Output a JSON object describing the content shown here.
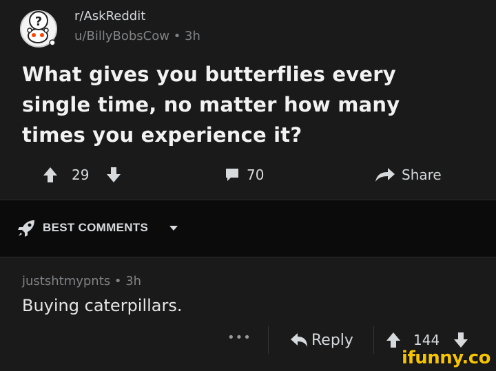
{
  "post": {
    "subreddit": "r/AskReddit",
    "author": "u/BillyBobsCow",
    "age": "3h",
    "title": "What gives you butterflies every single time, no matter how many times you experience it?",
    "upvotes": "29",
    "comments": "70",
    "share_label": "Share"
  },
  "sort": {
    "label": "BEST COMMENTS"
  },
  "comment": {
    "author": "justshtmypnts",
    "age": "3h",
    "body": "Buying caterpillars.",
    "more": "•••",
    "reply_label": "Reply",
    "score": "144"
  },
  "watermark": "ifunny.co",
  "colors": {
    "background": "#1a1a1b",
    "sortbar": "#0b0b0c",
    "text": "#d7dadc",
    "muted": "#818384",
    "watermark": "#f5c400"
  },
  "icons": [
    "subreddit-avatar-icon",
    "upvote-icon",
    "downvote-icon",
    "comment-icon",
    "share-icon",
    "rocket-icon",
    "caret-down-icon",
    "reply-icon"
  ]
}
